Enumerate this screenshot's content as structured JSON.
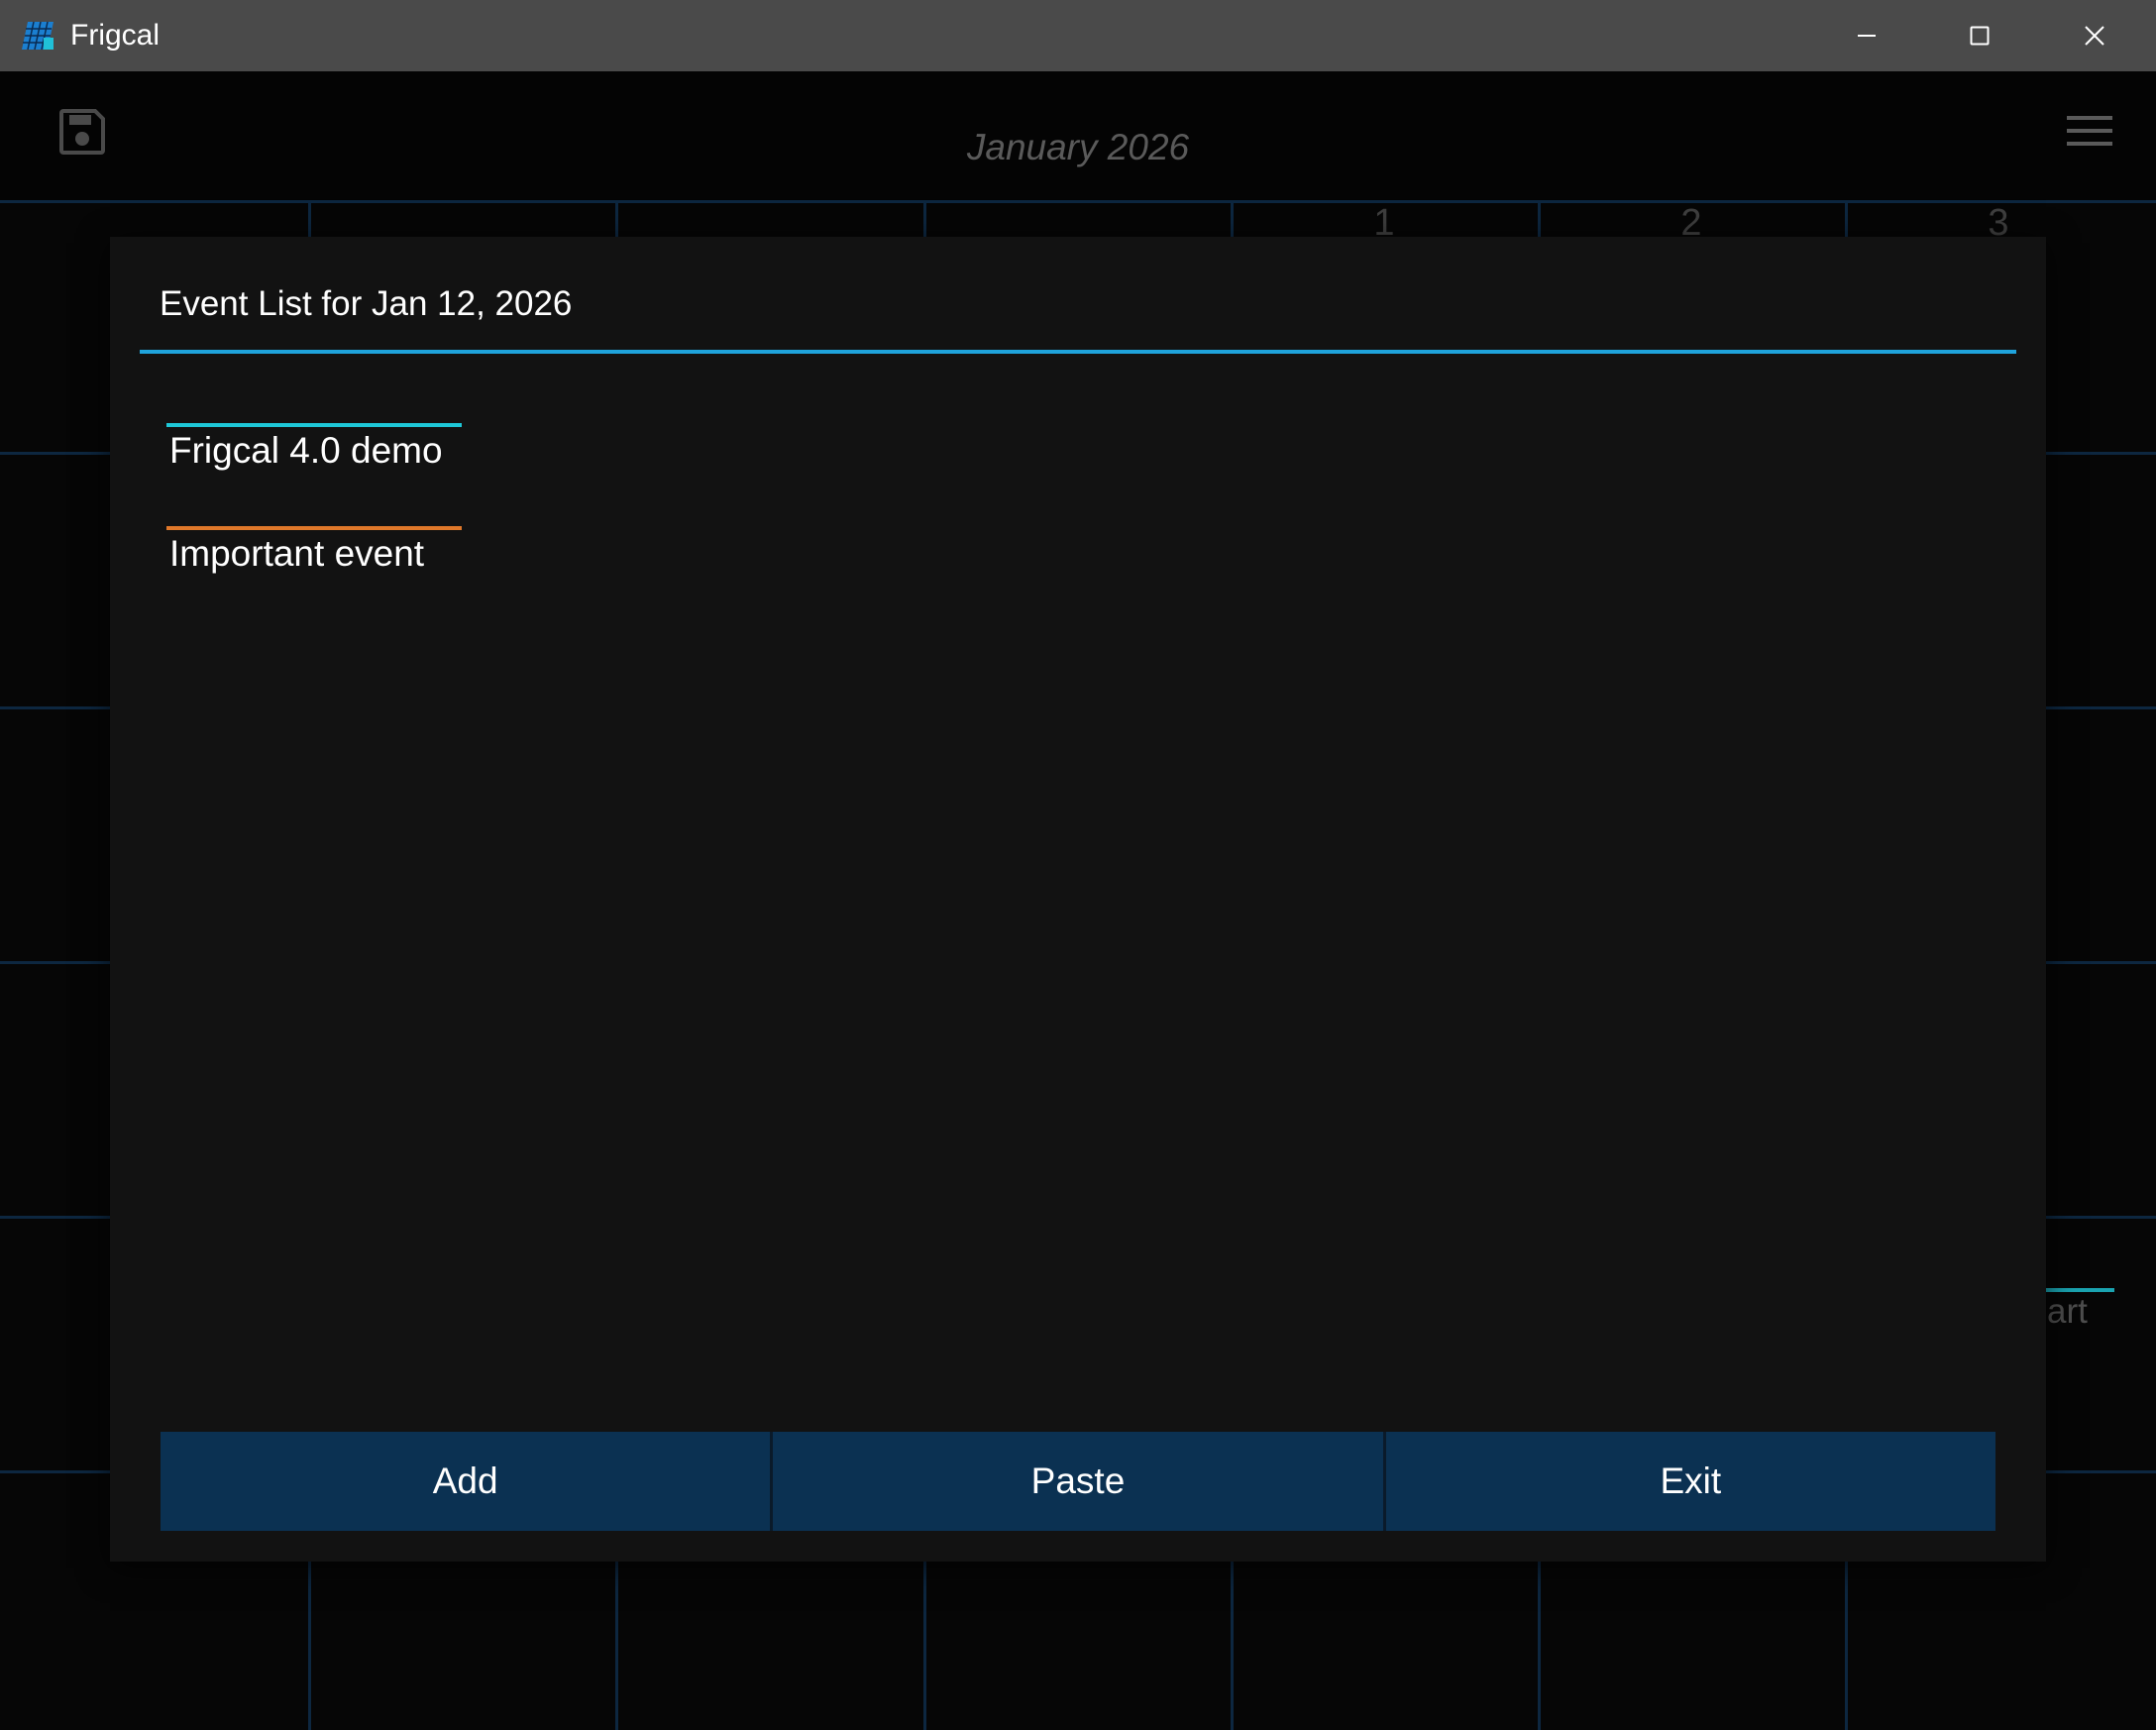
{
  "window": {
    "title": "Frigcal",
    "icon": "frigcal-calendar-icon",
    "controls": [
      "minimize-icon",
      "maximize-icon",
      "close-icon"
    ]
  },
  "appbar": {
    "save_icon": "floppy-disk-icon",
    "month_title": "January 2026",
    "menu_icon": "hamburger-menu-icon"
  },
  "calendar": {
    "visible_day_numbers": [
      "1",
      "2",
      "3"
    ],
    "peek_event_text": "art",
    "gridline_color": "#0d2740"
  },
  "dialog": {
    "title": "Event List for Jan 12, 2026",
    "divider_color": "#1fa3dc",
    "events": [
      {
        "label": "Frigcal 4.0 demo",
        "color": "#1ec8d8"
      },
      {
        "label": "Important event",
        "color": "#e0782a"
      }
    ],
    "buttons": {
      "add": "Add",
      "paste": "Paste",
      "exit": "Exit"
    },
    "button_color": "#0b3152"
  }
}
